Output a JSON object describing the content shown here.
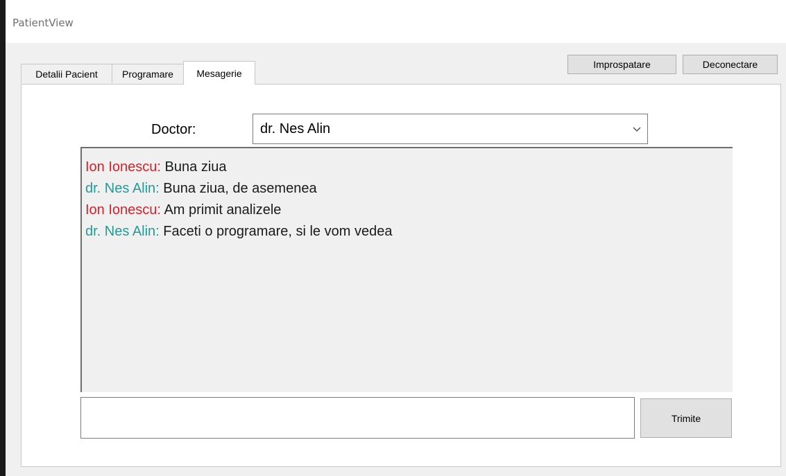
{
  "window": {
    "title": "PatientView"
  },
  "toolbar": {
    "refresh_label": "Improspatare",
    "logout_label": "Deconectare"
  },
  "tabs": [
    {
      "label": "Detalii Pacient",
      "active": false
    },
    {
      "label": "Programare",
      "active": false
    },
    {
      "label": "Mesagerie",
      "active": true
    }
  ],
  "doctor": {
    "label": "Doctor:",
    "selected": "dr. Nes Alin"
  },
  "chat": {
    "messages": [
      {
        "sender": "Ion Ionescu",
        "role": "patient",
        "text": "Buna ziua"
      },
      {
        "sender": "dr. Nes Alin",
        "role": "doctor",
        "text": "Buna ziua, de asemenea"
      },
      {
        "sender": "Ion Ionescu",
        "role": "patient",
        "text": "Am primit analizele"
      },
      {
        "sender": "dr. Nes Alin",
        "role": "doctor",
        "text": "Faceti o programare, si le vom vedea"
      }
    ]
  },
  "composer": {
    "value": "",
    "send_label": "Trimite"
  },
  "colors": {
    "patient": "#d8202a",
    "doctor": "#229a96",
    "separator": "#1a1a1a"
  }
}
